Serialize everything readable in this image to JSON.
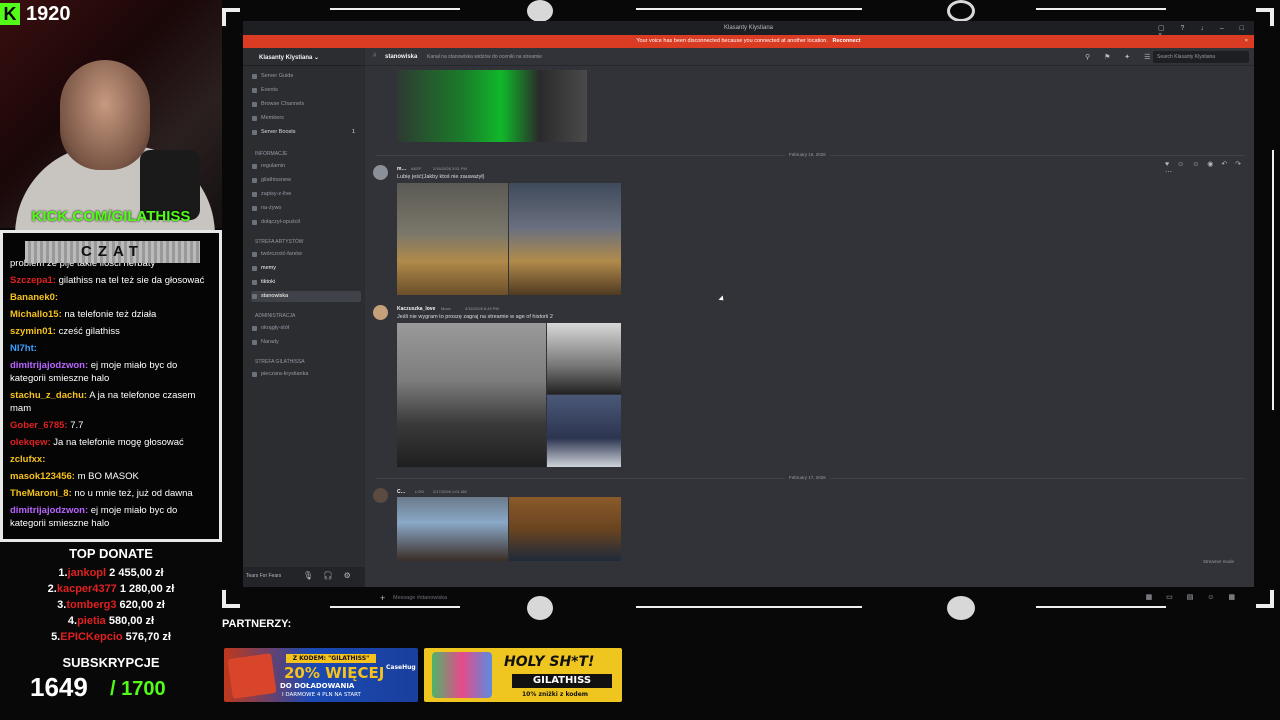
{
  "stream": {
    "kick_viewers": "1920",
    "kick_url": "KICK.COM/GILATHISS",
    "chat_title": "CZAT",
    "chat": [
      {
        "user": "",
        "text": "problem że pije takie ilości herbaty",
        "color": "#ffffff"
      },
      {
        "user": "Szczepa1:",
        "text": "gilathiss na tel też sie da głosować",
        "color": "#e02020"
      },
      {
        "user": "Bananek0:",
        "text": "",
        "color": "#f6c21c"
      },
      {
        "user": "Michallo15:",
        "text": "na telefonie też działa",
        "color": "#f6c21c"
      },
      {
        "user": "szymin01:",
        "text": "cześć gilathiss",
        "color": "#f6c21c"
      },
      {
        "user": "NI7ht:",
        "text": "",
        "color": "#3aa0ff"
      },
      {
        "user": "dimitrijajodzwon:",
        "text": "ej moje miało byc do kategorii smieszne halo",
        "color": "#b865ff"
      },
      {
        "user": "stachu_z_dachu:",
        "text": "A ja na telefonoe czasem mam",
        "color": "#f6c21c"
      },
      {
        "user": "Gober_6785:",
        "text": "7.7",
        "color": "#e02020"
      },
      {
        "user": "olekqew:",
        "text": "Ja na telefonie mogę głosować",
        "color": "#e02020"
      },
      {
        "user": "zclufxx:",
        "text": "",
        "color": "#f6c21c"
      },
      {
        "user": "masok123456:",
        "text": "m BO MASOK",
        "color": "#f6c21c"
      },
      {
        "user": "TheMaroni_8:",
        "text": "no u mnie też, już od dawna",
        "color": "#f6c21c"
      },
      {
        "user": "dimitrijajodzwon:",
        "text": "ej moje miało byc do kategorii smieszne halo",
        "color": "#b865ff"
      }
    ],
    "top_donate_title": "TOP DONATE",
    "donations": [
      {
        "rank": "1.",
        "name": "jankopl",
        "amount": "2 455,00 zł"
      },
      {
        "rank": "2.",
        "name": "kacper4377",
        "amount": "1 280,00 zł"
      },
      {
        "rank": "3.",
        "name": "tomberg3",
        "amount": "620,00 zł"
      },
      {
        "rank": "4.",
        "name": "pietia",
        "amount": "580,00 zł"
      },
      {
        "rank": "5.",
        "name": "EPICKepcio",
        "amount": "576,70 zł"
      }
    ],
    "subs_title": "SUBSKRYPCJE",
    "subs_count": "1649",
    "subs_goal": "/ 1700",
    "partners_label": "PARTNERZY:",
    "ad1": {
      "code": "Z KODEM: \"GILATHISS\"",
      "headline": "20% WIĘCEJ",
      "sub": "DO DOŁADOWANIA",
      "small": "I DARMOWE 4 PLN NA START",
      "brand": "CaseHug"
    },
    "ad2": {
      "headline": "HOLY SH*T!",
      "code": "GILATHISS",
      "small": "10% zniżki z kodem"
    }
  },
  "discord": {
    "window_title": "Klasanty Klystiana",
    "banner": "Your voice has been disconnected because you connected at another location.",
    "banner_action": "Reconnect",
    "server_name": "Klasanty Klystiana",
    "nav": [
      "Server Guide",
      "Events",
      "Browse Channels",
      "Members",
      "Server Boosts"
    ],
    "boost_count": "1",
    "categories": [
      {
        "name": "INFORMACJE",
        "channels": [
          "regulamin",
          "gilathissnew",
          "zapisy-z-live",
          "na-żywo",
          "dołączył-opuścił"
        ]
      },
      {
        "name": "STREFA ARTYSTÓW",
        "channels": [
          "twórczość-fanów",
          "memy",
          "tiktoki",
          "stanowiska"
        ]
      },
      {
        "name": "ADMINISTRACJA",
        "channels": [
          "okrągły-stół",
          "Narady"
        ]
      },
      {
        "name": "STREFA GILATHISSA",
        "channels": [
          "pieczara-krystianka"
        ]
      }
    ],
    "user_status": "Tears For Fears",
    "channel": "stanowiska",
    "topic": "Kanał na stanowiska widzów do oceniki na streamie",
    "search_placeholder": "Search Klasanty Klystiana",
    "dates": [
      "February 16, 2026",
      "February 17, 2026"
    ],
    "messages": [
      {
        "author": "m…",
        "tag": "AKEF",
        "time": "2/16/2026 3:51 PM",
        "text": "Lubię jeść(Jakby ktoś nie zauważył)"
      },
      {
        "author": "Kaczuszka_love",
        "tag": "Moce",
        "time": "2/16/2026 8:49 PM",
        "text": "Jeśli nie wygram to proszę zagraj na streamie w age of historii 2"
      },
      {
        "author": "C…",
        "tag": "LOKI",
        "time": "2/17/2026 1:01 AM",
        "text": ""
      }
    ],
    "composer_placeholder": "Message #stanowiska",
    "streamer_mode": "Streamer mode"
  }
}
